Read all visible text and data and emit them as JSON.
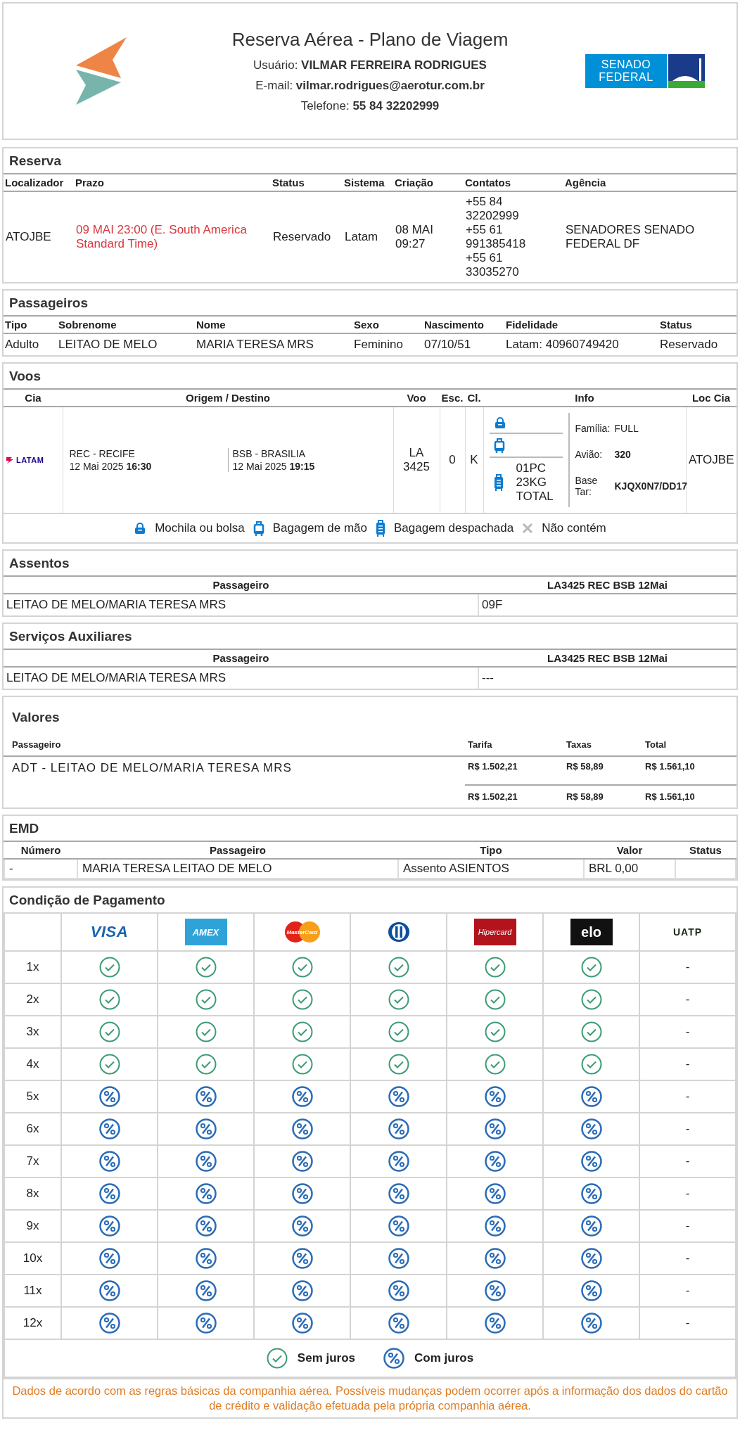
{
  "header": {
    "title": "Reserva Aérea - Plano de Viagem",
    "lines": [
      "Usuário: **VILMAR FERREIRA RODRIGUES**",
      "E-mail: **vilmar.rodrigues@aerotur.com.br**",
      "Telefone: **55 84 32202999**"
    ],
    "partner_logo": "SENADO FEDERAL"
  },
  "reserva": {
    "title": "Reserva",
    "columns": [
      "Localizador",
      "Prazo",
      "Status",
      "Sistema",
      "Criação",
      "Contatos",
      "Agência"
    ],
    "row": [
      "ATOJBE",
      "09 MAI 23:00 (E. South America Standard Time)",
      "Reservado",
      "Latam",
      "08 MAI 09:27",
      [
        "+55 84 32202999",
        "+55 61 991385418",
        "+55 61 33035270"
      ],
      "SENADORES SENADO FEDERAL DF"
    ]
  },
  "passageiros": {
    "title": "Passageiros",
    "columns": [
      "Tipo",
      "Sobrenome",
      "Nome",
      "Sexo",
      "Nascimento",
      "Fidelidade",
      "Status"
    ],
    "rows": [
      [
        "Adulto",
        "LEITAO DE MELO",
        "MARIA TERESA MRS",
        "Feminino",
        "07/10/51",
        "Latam: 40960749420",
        "Reservado"
      ]
    ]
  },
  "voos": {
    "title": "Voos",
    "columns": [
      "Cia",
      "Origem / Destino",
      "Voo",
      "Esc.",
      "Cl.",
      "Info",
      "Loc Cia"
    ],
    "flights": [
      {
        "airline": "LATAM",
        "origin": {
          "place": "REC - RECIFE",
          "date": "12 Mai 2025",
          "time": "16:30"
        },
        "destination": {
          "place": "BSB - BRASILIA",
          "date": "12 Mai 2025",
          "time": "19:15"
        },
        "flight": "LA 3425",
        "stops": "0",
        "class": "K",
        "baggage": [
          {
            "kind": "backpack"
          },
          {
            "kind": "carry_on"
          },
          {
            "kind": "checked",
            "text": "01PC 23KG TOTAL"
          }
        ],
        "info": [
          {
            "label": "Família:",
            "value": "FULL",
            "strong": false
          },
          {
            "label": "Avião:",
            "value": "320",
            "strong": true
          },
          {
            "label": "Base Tar:",
            "value": "KJQX0N7/DD17",
            "strong": true
          }
        ],
        "loc": "ATOJBE"
      }
    ],
    "legend": [
      {
        "kind": "backpack",
        "label": "Mochila ou bolsa"
      },
      {
        "kind": "carry_on",
        "label": "Bagagem de mão"
      },
      {
        "kind": "checked",
        "label": "Bagagem despachada"
      },
      {
        "kind": "none",
        "label": "Não contém"
      }
    ]
  },
  "assentos": {
    "title": "Assentos",
    "columns": [
      "Passageiro",
      "LA3425 REC BSB 12Mai"
    ],
    "rows": [
      [
        "LEITAO DE MELO/MARIA TERESA MRS",
        "09F"
      ]
    ]
  },
  "servicos": {
    "title": "Serviços Auxiliares",
    "columns": [
      "Passageiro",
      "LA3425 REC BSB 12Mai"
    ],
    "rows": [
      [
        "LEITAO DE MELO/MARIA TERESA MRS",
        "---"
      ]
    ]
  },
  "valores": {
    "title": "Valores",
    "columns": [
      "Passageiro",
      "Tarifa",
      "Taxas",
      "Total"
    ],
    "rows": [
      [
        "ADT - LEITAO DE MELO/MARIA TERESA MRS",
        "R$ 1.502,21",
        "R$ 58,89",
        "R$ 1.561,10"
      ]
    ],
    "totals": [
      "R$ 1.502,21",
      "R$ 58,89",
      "R$ 1.561,10"
    ]
  },
  "emd": {
    "title": "EMD",
    "columns": [
      "Número",
      "Passageiro",
      "Tipo",
      "Valor",
      "Status"
    ],
    "rows": [
      [
        "-",
        "MARIA TERESA LEITAO DE MELO",
        "Assento ASIENTOS",
        "BRL 0,00",
        ""
      ]
    ]
  },
  "pagamento": {
    "title": "Condição de Pagamento",
    "cards": [
      {
        "kind": "visa",
        "label": "VISA"
      },
      {
        "kind": "amex",
        "label": "AMEX"
      },
      {
        "kind": "mastercard",
        "label": "MasterCard"
      },
      {
        "kind": "diners"
      },
      {
        "kind": "hipercard",
        "label": "Hipercard"
      },
      {
        "kind": "elo",
        "label": "elo"
      },
      {
        "kind": "uatp",
        "label": "UATP"
      }
    ],
    "rows": [
      {
        "label": "1x",
        "cells": [
          {
            "kind": "free"
          },
          {
            "kind": "free"
          },
          {
            "kind": "free"
          },
          {
            "kind": "free"
          },
          {
            "kind": "free"
          },
          {
            "kind": "free"
          },
          {
            "kind": "text",
            "text": "-"
          }
        ]
      },
      {
        "label": "2x",
        "cells": [
          {
            "kind": "free"
          },
          {
            "kind": "free"
          },
          {
            "kind": "free"
          },
          {
            "kind": "free"
          },
          {
            "kind": "free"
          },
          {
            "kind": "free"
          },
          {
            "kind": "text",
            "text": "-"
          }
        ]
      },
      {
        "label": "3x",
        "cells": [
          {
            "kind": "free"
          },
          {
            "kind": "free"
          },
          {
            "kind": "free"
          },
          {
            "kind": "free"
          },
          {
            "kind": "free"
          },
          {
            "kind": "free"
          },
          {
            "kind": "text",
            "text": "-"
          }
        ]
      },
      {
        "label": "4x",
        "cells": [
          {
            "kind": "free"
          },
          {
            "kind": "free"
          },
          {
            "kind": "free"
          },
          {
            "kind": "free"
          },
          {
            "kind": "free"
          },
          {
            "kind": "free"
          },
          {
            "kind": "text",
            "text": "-"
          }
        ]
      },
      {
        "label": "5x",
        "cells": [
          {
            "kind": "interest"
          },
          {
            "kind": "interest"
          },
          {
            "kind": "interest"
          },
          {
            "kind": "interest"
          },
          {
            "kind": "interest"
          },
          {
            "kind": "interest"
          },
          {
            "kind": "text",
            "text": "-"
          }
        ]
      },
      {
        "label": "6x",
        "cells": [
          {
            "kind": "interest"
          },
          {
            "kind": "interest"
          },
          {
            "kind": "interest"
          },
          {
            "kind": "interest"
          },
          {
            "kind": "interest"
          },
          {
            "kind": "interest"
          },
          {
            "kind": "text",
            "text": "-"
          }
        ]
      },
      {
        "label": "7x",
        "cells": [
          {
            "kind": "interest"
          },
          {
            "kind": "interest"
          },
          {
            "kind": "interest"
          },
          {
            "kind": "interest"
          },
          {
            "kind": "interest"
          },
          {
            "kind": "interest"
          },
          {
            "kind": "text",
            "text": "-"
          }
        ]
      },
      {
        "label": "8x",
        "cells": [
          {
            "kind": "interest"
          },
          {
            "kind": "interest"
          },
          {
            "kind": "interest"
          },
          {
            "kind": "interest"
          },
          {
            "kind": "interest"
          },
          {
            "kind": "interest"
          },
          {
            "kind": "text",
            "text": "-"
          }
        ]
      },
      {
        "label": "9x",
        "cells": [
          {
            "kind": "interest"
          },
          {
            "kind": "interest"
          },
          {
            "kind": "interest"
          },
          {
            "kind": "interest"
          },
          {
            "kind": "interest"
          },
          {
            "kind": "interest"
          },
          {
            "kind": "text",
            "text": "-"
          }
        ]
      },
      {
        "label": "10x",
        "cells": [
          {
            "kind": "interest"
          },
          {
            "kind": "interest"
          },
          {
            "kind": "interest"
          },
          {
            "kind": "interest"
          },
          {
            "kind": "interest"
          },
          {
            "kind": "interest"
          },
          {
            "kind": "text",
            "text": "-"
          }
        ]
      },
      {
        "label": "11x",
        "cells": [
          {
            "kind": "interest"
          },
          {
            "kind": "interest"
          },
          {
            "kind": "interest"
          },
          {
            "kind": "interest"
          },
          {
            "kind": "interest"
          },
          {
            "kind": "interest"
          },
          {
            "kind": "text",
            "text": "-"
          }
        ]
      },
      {
        "label": "12x",
        "cells": [
          {
            "kind": "interest"
          },
          {
            "kind": "interest"
          },
          {
            "kind": "interest"
          },
          {
            "kind": "interest"
          },
          {
            "kind": "interest"
          },
          {
            "kind": "interest"
          },
          {
            "kind": "text",
            "text": "-"
          }
        ]
      }
    ],
    "legend": [
      {
        "kind": "free",
        "label": "Sem juros"
      },
      {
        "kind": "interest",
        "label": "Com juros"
      }
    ],
    "note": "Dados de acordo com as regras básicas da companhia aérea. Possíveis mudanças podem ocorrer após a informação dos dados do cartão de crédito e validação efetuada pela própria companhia aérea."
  }
}
